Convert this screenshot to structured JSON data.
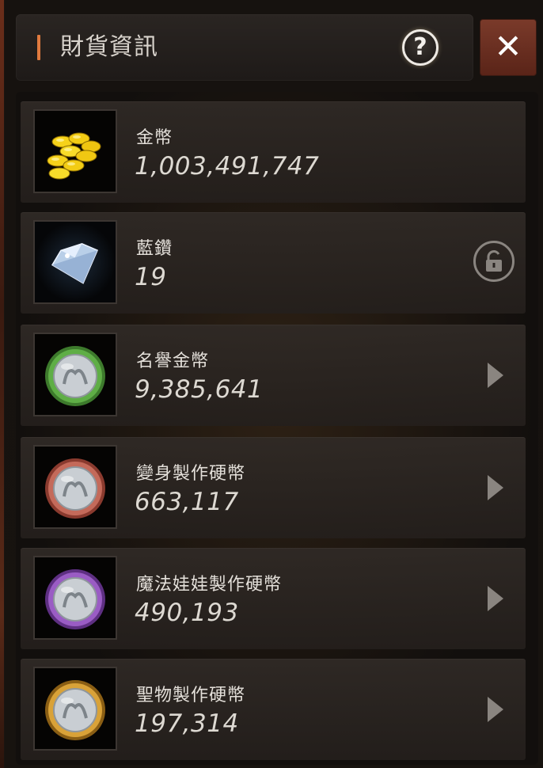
{
  "window": {
    "title": "財貨資訊",
    "help_symbol": "?",
    "close_symbol": "✕"
  },
  "currencies": [
    {
      "label": "金幣",
      "value": "1,003,491,747",
      "icon": "gold-coins-icon",
      "action": "none"
    },
    {
      "label": "藍鑽",
      "value": "19",
      "icon": "blue-diamond-icon",
      "action": "lock"
    },
    {
      "label": "名譽金幣",
      "value": "9,385,641",
      "icon": "honor-coin-icon",
      "action": "arrow",
      "ring_color": "#4f9a3c"
    },
    {
      "label": "變身製作硬幣",
      "value": "663,117",
      "icon": "polymorph-coin-icon",
      "action": "arrow",
      "ring_color": "#b85a4a"
    },
    {
      "label": "魔法娃娃製作硬幣",
      "value": "490,193",
      "icon": "magic-doll-coin-icon",
      "action": "arrow",
      "ring_color": "#8f4fb8"
    },
    {
      "label": "聖物製作硬幣",
      "value": "197,314",
      "icon": "relic-coin-icon",
      "action": "arrow",
      "ring_color": "#c8922a"
    }
  ],
  "colors": {
    "accent": "#e07a3e",
    "close_button": "#6a2e20"
  }
}
